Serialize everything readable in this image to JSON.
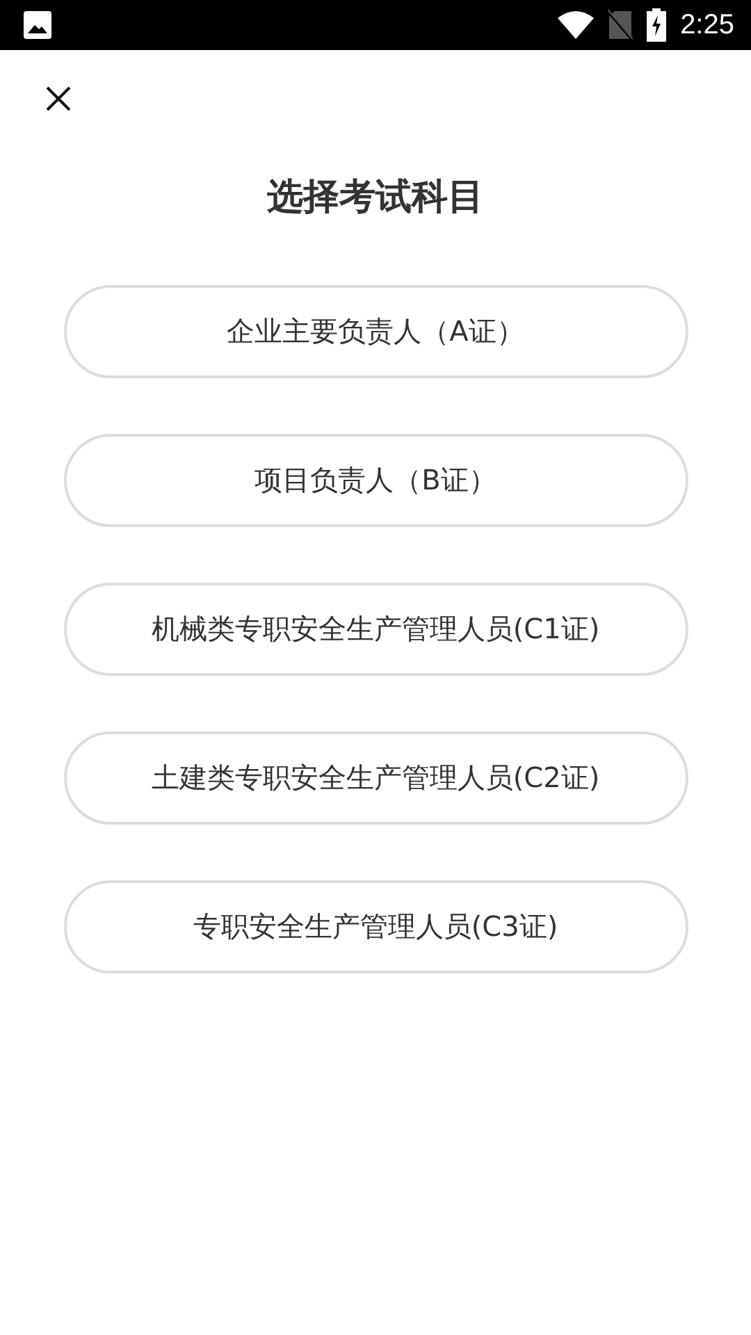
{
  "status_bar": {
    "time": "2:25"
  },
  "title": "选择考试科目",
  "options": [
    {
      "label": "企业主要负责人（A证）"
    },
    {
      "label": "项目负责人（B证）"
    },
    {
      "label": "机械类专职安全生产管理人员(C1证)"
    },
    {
      "label": "土建类专职安全生产管理人员(C2证)"
    },
    {
      "label": "专职安全生产管理人员(C3证)"
    }
  ]
}
